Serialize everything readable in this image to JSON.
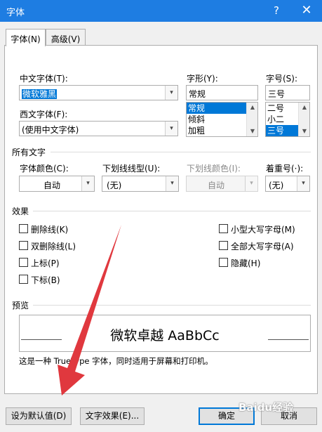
{
  "window": {
    "title": "字体",
    "help_label": "?",
    "close_label": "✕"
  },
  "tabs": [
    {
      "label": "字体(N)",
      "active": true
    },
    {
      "label": "高级(V)",
      "active": false
    }
  ],
  "chinese_font": {
    "label": "中文字体(T):",
    "value": "微软雅黑"
  },
  "western_font": {
    "label": "西文字体(F):",
    "value": "(使用中文字体)"
  },
  "font_style": {
    "label": "字形(Y):",
    "value": "常规",
    "options": [
      "常规",
      "倾斜",
      "加粗"
    ],
    "selected_index": 0
  },
  "font_size": {
    "label": "字号(S):",
    "value": "三号",
    "options": [
      "二号",
      "小二",
      "三号"
    ],
    "selected_index": 2
  },
  "all_text": {
    "section_label": "所有文字",
    "font_color": {
      "label": "字体颜色(C):",
      "value": "自动"
    },
    "underline_style": {
      "label": "下划线线型(U):",
      "value": "(无)"
    },
    "underline_color": {
      "label": "下划线颜色(I):",
      "value": "自动"
    },
    "emphasis": {
      "label": "着重号(·):",
      "value": "(无)"
    }
  },
  "effects": {
    "section_label": "效果",
    "left": [
      {
        "label": "删除线(K)",
        "checked": false
      },
      {
        "label": "双删除线(L)",
        "checked": false
      },
      {
        "label": "上标(P)",
        "checked": false
      },
      {
        "label": "下标(B)",
        "checked": false
      }
    ],
    "right": [
      {
        "label": "小型大写字母(M)",
        "checked": false
      },
      {
        "label": "全部大写字母(A)",
        "checked": false
      },
      {
        "label": "隐藏(H)",
        "checked": false
      }
    ]
  },
  "preview": {
    "section_label": "预览",
    "sample": "微软卓越  AaBbCc",
    "description": "这是一种 TrueType 字体，同时适用于屏幕和打印机。"
  },
  "buttons": {
    "set_default": "设为默认值(D)",
    "text_effects": "文字效果(E)...",
    "ok": "确定",
    "cancel": "取消"
  },
  "watermark": "Baidu经验",
  "colors": {
    "titlebar": "#1e7de2",
    "selection": "#0078d7",
    "annotation_arrow": "#e0383e"
  }
}
